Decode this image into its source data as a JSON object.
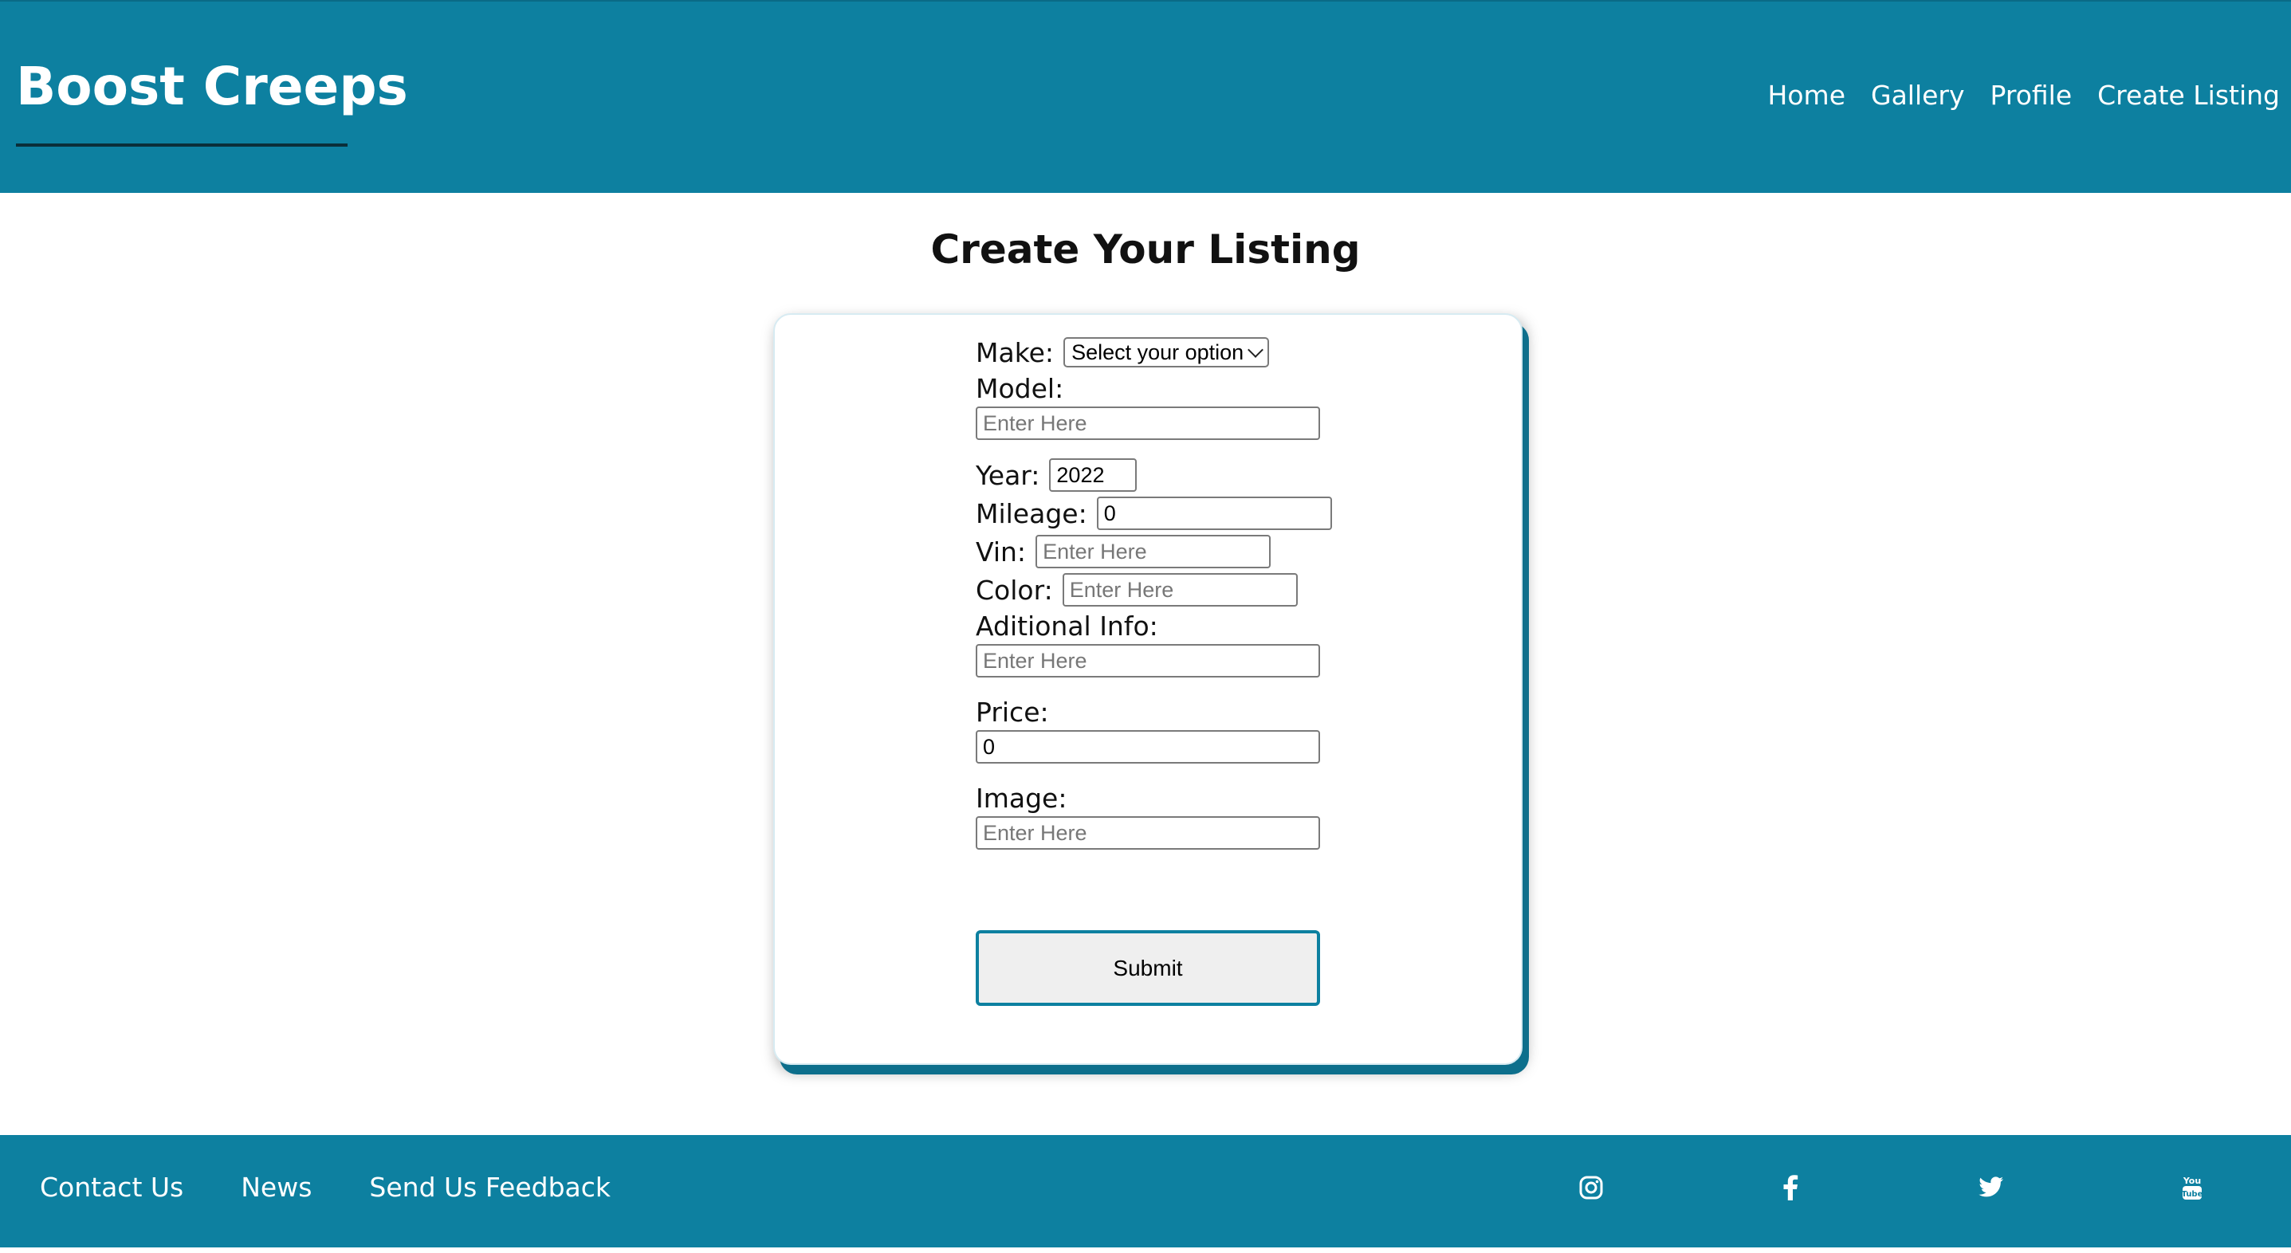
{
  "header": {
    "brand": "Boost Creeps",
    "nav": [
      "Home",
      "Gallery",
      "Profile",
      "Create Listing"
    ]
  },
  "main": {
    "title": "Create Your Listing",
    "form": {
      "make": {
        "label": "Make:",
        "selected": "Select your option"
      },
      "model": {
        "label": "Model:",
        "placeholder": "Enter Here"
      },
      "year": {
        "label": "Year:",
        "value": "2022"
      },
      "mileage": {
        "label": "Mileage:",
        "value": "0"
      },
      "vin": {
        "label": "Vin:",
        "placeholder": "Enter Here"
      },
      "color": {
        "label": "Color:",
        "placeholder": "Enter Here"
      },
      "additional_info": {
        "label": "Aditional Info:",
        "placeholder": "Enter Here"
      },
      "price": {
        "label": "Price:",
        "value": "0"
      },
      "image": {
        "label": "Image:",
        "placeholder": "Enter Here"
      },
      "submit_label": "Submit"
    }
  },
  "footer": {
    "links": [
      "Contact Us",
      "News",
      "Send Us Feedback"
    ],
    "social_icons": [
      "instagram-icon",
      "facebook-icon",
      "twitter-icon",
      "youtube-icon"
    ]
  },
  "colors": {
    "accent": "#0d80a0",
    "card_shadow": "#0d6f8c"
  }
}
